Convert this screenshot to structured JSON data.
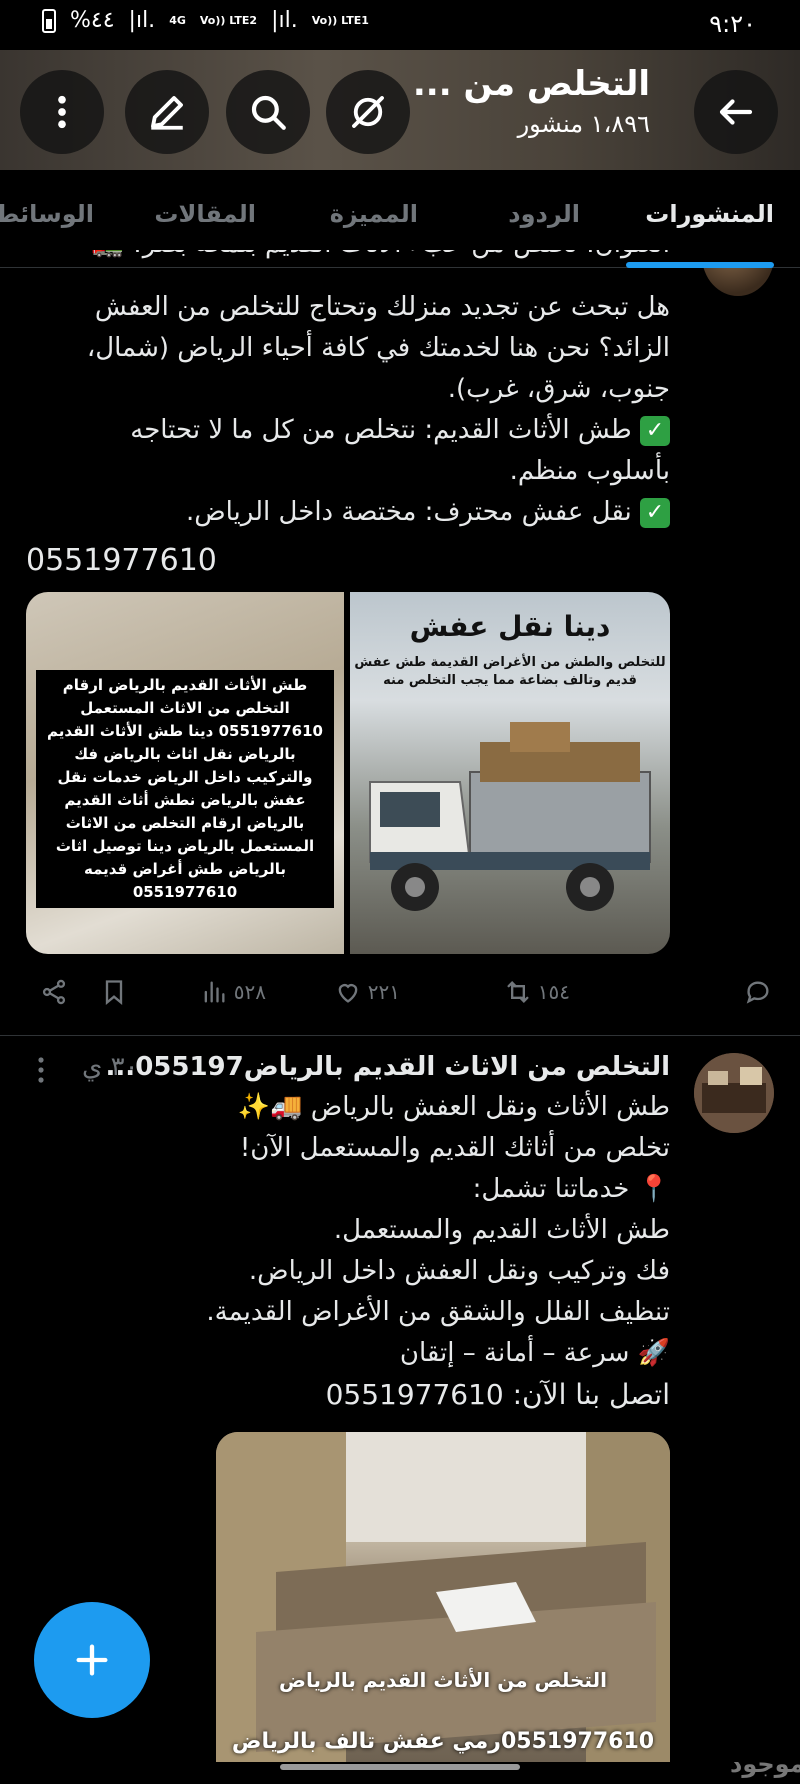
{
  "status_bar": {
    "time": "٩:٢٠",
    "battery": "%٤٤",
    "network_1": "4G",
    "network_2": "Vo)) LTE2",
    "network_3": "Vo)) LTE1"
  },
  "header": {
    "title": "التخلص من ...",
    "subtitle": "١،٨٩٦ منشور"
  },
  "tabs": [
    {
      "label": "المنشورات",
      "active": true
    },
    {
      "label": "الردود",
      "active": false
    },
    {
      "label": "المميزة",
      "active": false
    },
    {
      "label": "المقالات",
      "active": false
    },
    {
      "label": "الوسائط",
      "active": false
    }
  ],
  "post1": {
    "partial_line": "العنوان: تخلص من عبء الأثاث القديم بلمحة بصر! 🚛",
    "lines": [
      "هل تبحث عن تجديد منزلك وتحتاج للتخلص من العفش",
      "الزائد؟ نحن هنا لخدمتك في كافة أحياء الرياض (شمال،",
      "جنوب، شرق، غرب).",
      "طش الأثاث القديم: نتخلص من كل ما لا تحتاجه",
      "بأسلوب منظم.",
      "نقل عفش محترف:  مختصة داخل الرياض."
    ],
    "phone": "0551977610",
    "image_right_title": "دينا نقل عفش",
    "image_right_caption": "للتخلص والطش من الأغراض القديمة طش عفش قديم وتالف بضاعة مما يجب التخلص منه",
    "image_left_caption": "طش الأثاث القديم بالرياض ارقام التخلص من الاثاث المستعمل 0551977610 دينا طش الأثاث القديم بالرياض نقل اثاث بالرياض فك والتركيب داخل الرياض خدمات نقل عفش بالرياض نطش أثاث القديم بالرياض ارقام التخلص من الاثاث المستعمل بالرياض دينا توصيل اثاث بالرياض طش أغراض قديمه 0551977610",
    "views": "٥٢٨",
    "likes": "٢٢١",
    "reposts": "١٥٤"
  },
  "post2": {
    "title": "التخلص من الاثاث القديم بالرياض055197...",
    "time": "٣٠ ي",
    "lines": [
      "طش الأثاث ونقل العفش بالرياض 🚚✨",
      "تخلص من أثاثك القديم والمستعمل الآن!",
      "📍 خدماتنا تشمل:",
      "طش الأثاث القديم والمستعمل.",
      "فك وتركيب ونقل العفش داخل الرياض.",
      "تنظيف الفلل والشقق من الأغراض القديمة.",
      "🚀 سرعة – أمانة – إتقان",
      "اتصل بنا الآن: 0551977610"
    ],
    "image_caption_1": "التخلص من الأثاث القديم بالرياض",
    "image_caption_2": "0551977610رمي عفش تالف بالرياض"
  },
  "watermark": "موجود",
  "colors": {
    "accent": "#1d9bf0",
    "background": "#000000",
    "text": "#e7e9ea",
    "muted": "#71767b",
    "check_green": "#2ea043"
  }
}
